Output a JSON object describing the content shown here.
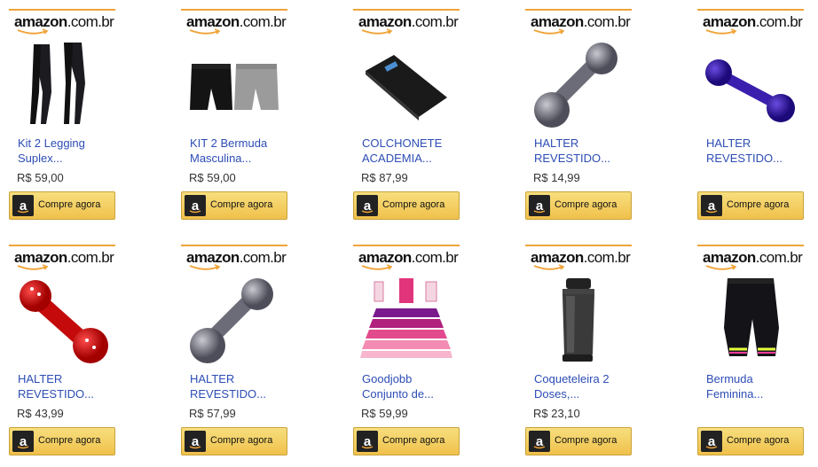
{
  "brand": {
    "logo_text": "amazon",
    "logo_domain": ".com.br",
    "accent": "#f0a439",
    "button_color": "#f0c14b",
    "link_color": "#2d4db5"
  },
  "products": [
    {
      "title_line1": "Kit 2 Legging",
      "title_line2": "Suplex...",
      "price": "R$ 59,00",
      "buy_label": "Compre agora",
      "image": "black-leggings"
    },
    {
      "title_line1": "KIT 2 Bermuda",
      "title_line2": "Masculina...",
      "price": "R$ 59,00",
      "buy_label": "Compre agora",
      "image": "shorts-pair"
    },
    {
      "title_line1": "COLCHONETE",
      "title_line2": "ACADEMIA...",
      "price": "R$ 87,99",
      "buy_label": "Compre agora",
      "image": "exercise-mat"
    },
    {
      "title_line1": "HALTER",
      "title_line2": "REVESTIDO...",
      "price": "R$ 14,99",
      "buy_label": "Compre agora",
      "image": "dumbbell-silver"
    },
    {
      "title_line1": "HALTER",
      "title_line2": "REVESTIDO...",
      "price": "",
      "buy_label": "Compre agora",
      "image": "dumbbell-purple"
    },
    {
      "title_line1": "HALTER",
      "title_line2": "REVESTIDO...",
      "price": "R$ 43,99",
      "buy_label": "Compre agora",
      "image": "dumbbell-red"
    },
    {
      "title_line1": "HALTER",
      "title_line2": "REVESTIDO...",
      "price": "R$ 57,99",
      "buy_label": "Compre agora",
      "image": "dumbbell-silver"
    },
    {
      "title_line1": "Goodjobb",
      "title_line2": "Conjunto de...",
      "price": "R$ 59,99",
      "buy_label": "Compre agora",
      "image": "resistance-bands"
    },
    {
      "title_line1": "Coqueteleira 2",
      "title_line2": "Doses,...",
      "price": "R$ 23,10",
      "buy_label": "Compre agora",
      "image": "shaker-bottle"
    },
    {
      "title_line1": "Bermuda",
      "title_line2": "Feminina...",
      "price": "",
      "buy_label": "Compre agora",
      "image": "cycling-shorts"
    }
  ]
}
